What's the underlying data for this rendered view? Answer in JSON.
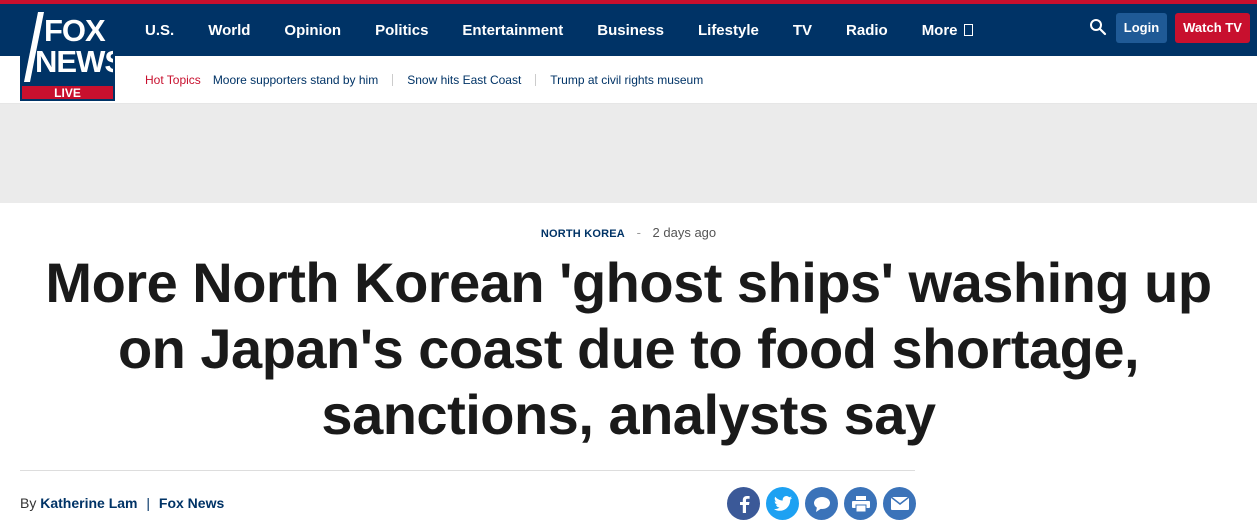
{
  "header": {
    "logo": {
      "line1": "FOX",
      "line2": "NEWS",
      "badge": "LIVE"
    },
    "nav": [
      {
        "label": "U.S."
      },
      {
        "label": "World"
      },
      {
        "label": "Opinion"
      },
      {
        "label": "Politics"
      },
      {
        "label": "Entertainment"
      },
      {
        "label": "Business"
      },
      {
        "label": "Lifestyle"
      },
      {
        "label": "TV"
      },
      {
        "label": "Radio"
      },
      {
        "label": "More"
      }
    ],
    "login_label": "Login",
    "watch_label": "Watch TV",
    "search_icon": "search-icon"
  },
  "hot_topics": {
    "label": "Hot Topics",
    "links": [
      "Moore supporters stand by him",
      "Snow hits East Coast",
      "Trump at civil rights museum"
    ]
  },
  "article": {
    "category": "NORTH KOREA",
    "separator": "-",
    "time": "2 days ago",
    "headline": "More North Korean 'ghost ships' washing up on Japan's coast due to food shortage, sanctions, analysts say",
    "byline": {
      "prefix": "By",
      "author": "Katherine Lam",
      "separator": "|",
      "source": "Fox News"
    },
    "share_buttons": [
      {
        "icon": "facebook-icon",
        "glyph": "f",
        "color": "#3b5998"
      },
      {
        "icon": "twitter-icon",
        "glyph": "t",
        "color": "#1da1f2"
      },
      {
        "icon": "comment-icon",
        "glyph": "c",
        "color": "#3b73b9"
      },
      {
        "icon": "print-icon",
        "glyph": "p",
        "color": "#3b73b9"
      },
      {
        "icon": "email-icon",
        "glyph": "e",
        "color": "#3b73b9"
      }
    ]
  },
  "colors": {
    "brand_blue": "#003366",
    "brand_red": "#c8102e",
    "ad_band": "#ebebeb"
  }
}
